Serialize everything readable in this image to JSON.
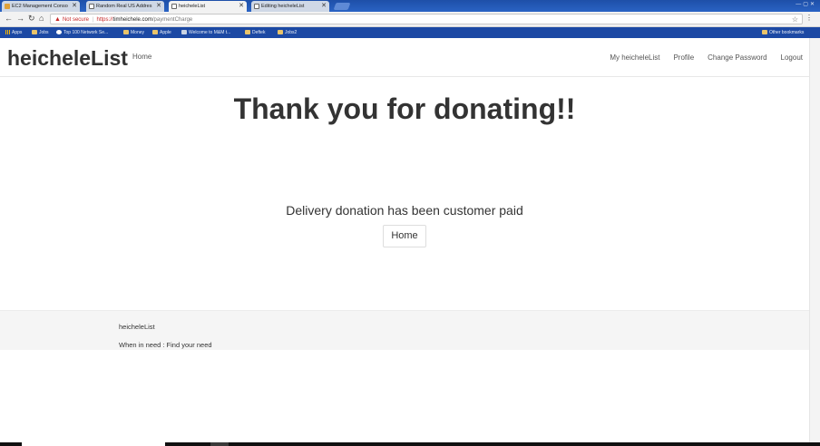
{
  "browser": {
    "tabs": [
      {
        "title": "EC2 Management Conso",
        "active": false,
        "icon": "aws-icon"
      },
      {
        "title": "Random Real US Addres",
        "active": false,
        "icon": "page-icon"
      },
      {
        "title": "heicheleList",
        "active": true,
        "icon": "doc-icon"
      },
      {
        "title": "Editing heicheleList",
        "active": false,
        "icon": "page-icon"
      }
    ],
    "address": {
      "security_label": "Not secure",
      "scheme": "https://",
      "host": "timheichele.com",
      "path": "/paymentCharge"
    },
    "bookmarks": [
      {
        "label": "Apps",
        "icon": "apps-icon"
      },
      {
        "label": "Jobs",
        "icon": "folder-icon"
      },
      {
        "label": "Top 100 Network Se...",
        "icon": "eye-icon"
      },
      {
        "label": "Money",
        "icon": "folder-icon"
      },
      {
        "label": "Apple",
        "icon": "folder-icon"
      },
      {
        "label": "Welcome to M&M t...",
        "icon": "page-icon"
      },
      {
        "label": "Deftek",
        "icon": "folder-icon"
      },
      {
        "label": "Jobs2",
        "icon": "folder-icon"
      }
    ],
    "other_bookmarks": "Other bookmarks"
  },
  "navbar": {
    "brand": "heicheleList",
    "home": "Home",
    "right_links": [
      "My heicheleList",
      "Profile",
      "Change Password",
      "Logout"
    ]
  },
  "main": {
    "headline": "Thank you for donating!!",
    "message": "Delivery donation has been customer paid",
    "home_button": "Home"
  },
  "footer": {
    "title": "heicheleList",
    "tagline": "When in need : Find your need"
  }
}
